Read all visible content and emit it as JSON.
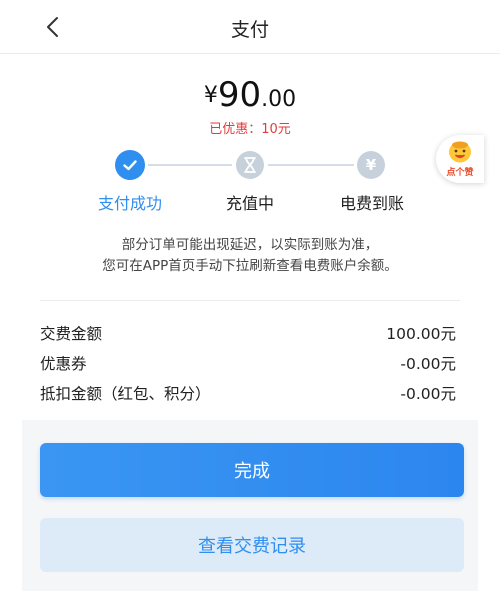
{
  "nav": {
    "title": "支付",
    "back_icon": "chevron-left-icon"
  },
  "payment": {
    "currency": "¥",
    "amount_int": "90",
    "amount_dec": ".00",
    "discount_text": "已优惠：10元"
  },
  "badge": {
    "text": "点个赞",
    "icon": "smiley-icon"
  },
  "steps": [
    {
      "label": "支付成功",
      "status": "done",
      "icon": "check-icon"
    },
    {
      "label": "充值中",
      "status": "pending",
      "icon": "hourglass-icon"
    },
    {
      "label": "电费到账",
      "status": "pending",
      "icon": "yen-icon"
    }
  ],
  "notice": {
    "line1": "部分订单可能出现延迟，以实际到账为准，",
    "line2": "您可在APP首页手动下拉刷新查看电费账户余额。"
  },
  "details": [
    {
      "label": "交费金额",
      "value": "100.00元"
    },
    {
      "label": "优惠券",
      "value": "-0.00元"
    },
    {
      "label": "抵扣金额（红包、积分）",
      "value": "-0.00元"
    }
  ],
  "buttons": {
    "done": "完成",
    "records": "查看交费记录"
  },
  "colors": {
    "accent": "#2f8ff0",
    "discount_red": "#e33b3b",
    "inactive_step": "#c7d1dc"
  }
}
